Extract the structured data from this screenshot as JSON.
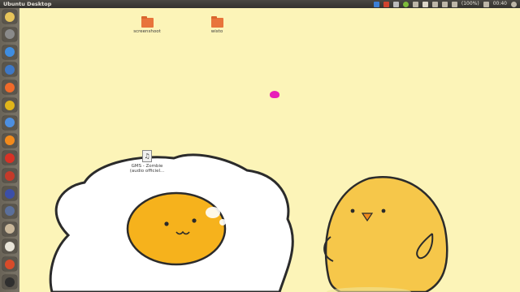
{
  "top_panel": {
    "title": "Ubuntu Desktop",
    "battery": "(100%)",
    "clock": "00:40"
  },
  "launcher": {
    "items": [
      {
        "name": "dash-icon",
        "color": "#e7c45a"
      },
      {
        "name": "files-icon",
        "color": "#8a8a8a"
      },
      {
        "name": "chrome-icon",
        "color": "#3f8de0"
      },
      {
        "name": "libreoffice-writer-icon",
        "color": "#3e78c6"
      },
      {
        "name": "software-center-icon",
        "color": "#f06a2a"
      },
      {
        "name": "app-icon",
        "color": "#e0b51a"
      },
      {
        "name": "chromium-icon",
        "color": "#4d8fe0"
      },
      {
        "name": "firefox-icon",
        "color": "#f28a1b"
      },
      {
        "name": "app-red-icon",
        "color": "#d83225"
      },
      {
        "name": "app-icon-2",
        "color": "#c43a2a"
      },
      {
        "name": "app-icon-3",
        "color": "#3c4fa8"
      },
      {
        "name": "app-icon-4",
        "color": "#5b6f9a"
      },
      {
        "name": "app-icon-5",
        "color": "#c9b79a"
      },
      {
        "name": "app-icon-6",
        "color": "#e8e4d8"
      },
      {
        "name": "app-icon-7",
        "color": "#d84b2a"
      },
      {
        "name": "terminal-icon",
        "color": "#2f2f2f"
      }
    ]
  },
  "desktop": {
    "icons": [
      {
        "label": "screenshoot"
      },
      {
        "label": "wisto"
      },
      {
        "label": "GMS - Zombie (audio officiel..."
      }
    ]
  },
  "colors": {
    "background": "#fcf4b8",
    "accent_orange": "#e8743b"
  }
}
